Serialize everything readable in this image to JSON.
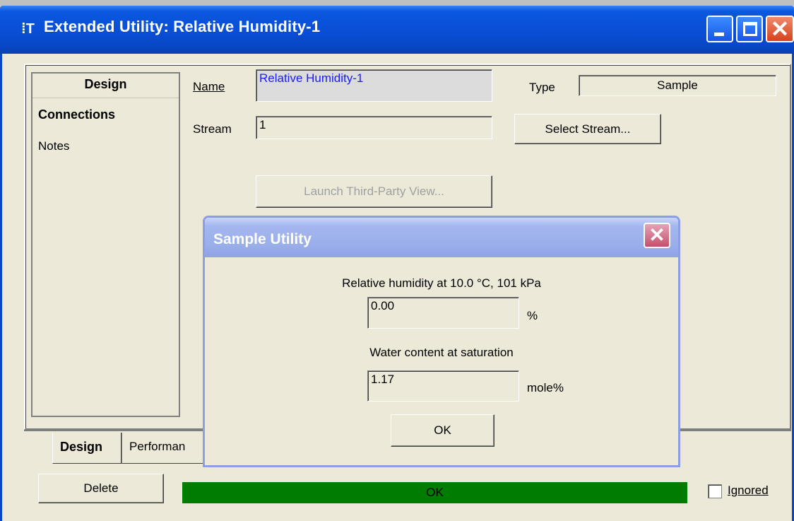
{
  "window": {
    "title": "Extended Utility: Relative Humidity-1",
    "app_icon": "hysys-icon",
    "controls": {
      "minimize": "minimize",
      "maximize": "maximize",
      "close": "✕"
    }
  },
  "nav": {
    "title": "Design",
    "items": [
      "Connections",
      "Notes"
    ]
  },
  "form": {
    "name_label": "Name",
    "name_value": "Relative Humidity-1",
    "type_label": "Type",
    "type_value": "Sample",
    "stream_label": "Stream",
    "stream_value": "1",
    "select_stream_button": "Select Stream...",
    "launch_button": "Launch Third-Party View..."
  },
  "tabs": [
    "Design",
    "Performan"
  ],
  "footer": {
    "delete_button": "Delete",
    "status_text": "OK",
    "ignored_label": "Ignored"
  },
  "dialog": {
    "title": "Sample Utility",
    "close": "✕",
    "rh_label": "Relative humidity at 10.0 °C, 101 kPa",
    "rh_value": "0.00",
    "rh_unit": "%",
    "water_label": "Water content at saturation",
    "water_value": "1.17",
    "water_unit": "mole%",
    "ok_button": "OK"
  },
  "colors": {
    "titlebar": "#0a4fd6",
    "dialog_titlebar": "#9aaeea",
    "status_green": "#007d00",
    "window_bg": "#ece9d8"
  }
}
